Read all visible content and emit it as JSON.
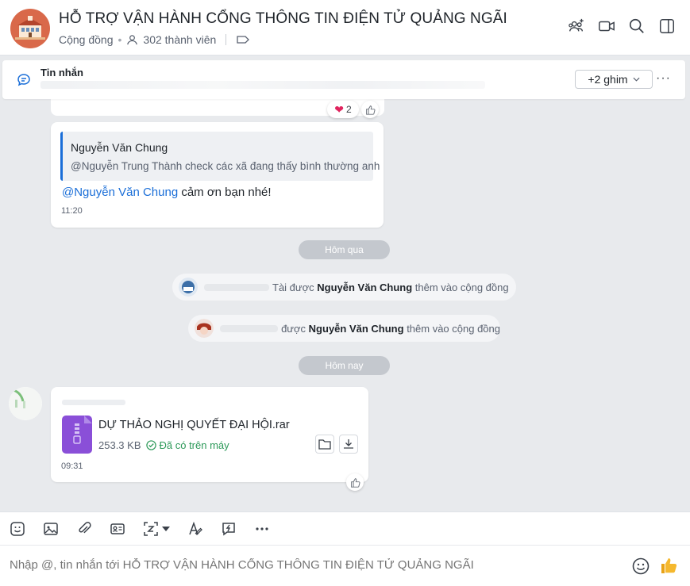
{
  "header": {
    "title": "HỖ TRỢ VẬN HÀNH CỔNG THÔNG TIN ĐIỆN TỬ QUẢNG NGÃI",
    "type_label": "Cộng đồng",
    "member_count": "302 thành viên",
    "actions": [
      "add-member-icon",
      "video-call-icon",
      "search-icon",
      "sidebar-toggle-icon"
    ]
  },
  "pinned": {
    "label": "Tin nhắn",
    "pin_button": "+2 ghim",
    "more": "···"
  },
  "messages": {
    "previous": {
      "reaction_count": "2"
    },
    "reply": {
      "quote_author": "Nguyễn Văn Chung",
      "quote_text": "@Nguyễn Trung Thành check các xã đang thấy bình thường anh",
      "mention": "@Nguyễn Văn Chung",
      "text": " cảm ơn bạn nhé!",
      "time": "11:20"
    },
    "divider_yesterday": "Hôm qua",
    "system1": {
      "prefix": "Tài được",
      "actor": "Nguyễn Văn Chung",
      "suffix": "thêm vào cộng đồng"
    },
    "system2": {
      "prefix": "được",
      "actor": "Nguyễn Văn Chung",
      "suffix": "thêm vào cộng đồng"
    },
    "divider_today": "Hôm nay",
    "file": {
      "name": "DỰ THẢO NGHỊ QUYẾT ĐẠI HỘI.rar",
      "size": "253.3 KB",
      "status": "Đã có trên máy",
      "time": "09:31"
    }
  },
  "composer": {
    "placeholder": "Nhập @, tin nhắn tới HỖ TRỢ VẬN HÀNH CỔNG THÔNG TIN ĐIỆN TỬ QUẢNG NGÃI",
    "tools": [
      "sticker-icon",
      "image-icon",
      "attachment-icon",
      "contact-card-icon",
      "screenshot-icon",
      "format-text-icon",
      "quick-message-icon",
      "more-icon"
    ]
  },
  "colors": {
    "accent": "#1a6ed8",
    "success": "#2e9a5a",
    "file": "#8a4fd8",
    "avatar": "#d9694a"
  }
}
